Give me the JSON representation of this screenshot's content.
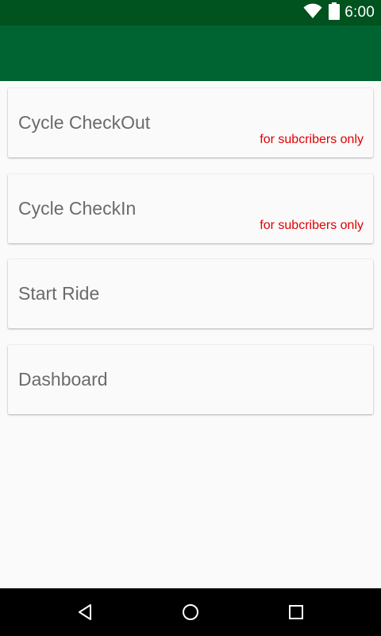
{
  "status_bar": {
    "time": "6:00",
    "icons": [
      "wifi-icon",
      "battery-icon"
    ]
  },
  "colors": {
    "status_bar": "#00521f",
    "app_bar": "#006432",
    "background": "#fafafa",
    "note_text": "#e00000",
    "title_text": "#6b6b6b"
  },
  "menu": {
    "items": [
      {
        "label": "Cycle CheckOut",
        "note": "for subcribers only"
      },
      {
        "label": "Cycle CheckIn",
        "note": "for subcribers only"
      },
      {
        "label": "Start Ride"
      },
      {
        "label": "Dashboard"
      }
    ]
  },
  "nav_bar": {
    "buttons": [
      "back-icon",
      "home-icon",
      "recents-icon"
    ]
  }
}
